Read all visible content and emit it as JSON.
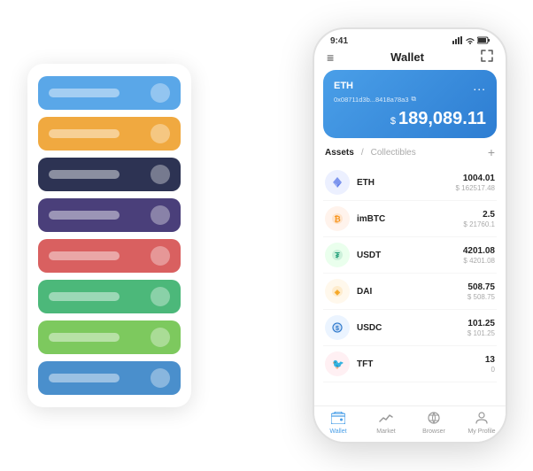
{
  "cardStack": {
    "items": [
      {
        "color": "card-blue"
      },
      {
        "color": "card-orange"
      },
      {
        "color": "card-dark"
      },
      {
        "color": "card-purple"
      },
      {
        "color": "card-red"
      },
      {
        "color": "card-green"
      },
      {
        "color": "card-lightgreen"
      },
      {
        "color": "card-steelblue"
      }
    ]
  },
  "phone": {
    "statusBar": {
      "time": "9:41",
      "signal": "●●●",
      "wifi": "▲",
      "battery": "█"
    },
    "header": {
      "menuIcon": "≡",
      "title": "Wallet",
      "expandIcon": "⤢"
    },
    "ethCard": {
      "label": "ETH",
      "dots": "...",
      "address": "0x08711d3b...8418a78a3",
      "addressIcon": "⧉",
      "balanceDollar": "$",
      "balance": "189,089.11"
    },
    "assets": {
      "activeTab": "Assets",
      "slash": "/",
      "inactiveTab": "Collectibles",
      "addIcon": "+"
    },
    "assetList": [
      {
        "name": "ETH",
        "iconEmoji": "◈",
        "iconClass": "icon-eth",
        "amount": "1004.01",
        "usdValue": "$ 162517.48"
      },
      {
        "name": "imBTC",
        "iconEmoji": "₿",
        "iconClass": "icon-imbtc",
        "amount": "2.5",
        "usdValue": "$ 21760.1"
      },
      {
        "name": "USDT",
        "iconEmoji": "₮",
        "iconClass": "icon-usdt",
        "amount": "4201.08",
        "usdValue": "$ 4201.08"
      },
      {
        "name": "DAI",
        "iconEmoji": "◎",
        "iconClass": "icon-dai",
        "amount": "508.75",
        "usdValue": "$ 508.75"
      },
      {
        "name": "USDC",
        "iconEmoji": "⊕",
        "iconClass": "icon-usdc",
        "amount": "101.25",
        "usdValue": "$ 101.25"
      },
      {
        "name": "TFT",
        "iconEmoji": "❦",
        "iconClass": "icon-tft",
        "amount": "13",
        "usdValue": "0"
      }
    ],
    "nav": [
      {
        "icon": "◎",
        "label": "Wallet",
        "active": true
      },
      {
        "icon": "📈",
        "label": "Market",
        "active": false
      },
      {
        "icon": "🌐",
        "label": "Browser",
        "active": false
      },
      {
        "icon": "👤",
        "label": "My Profile",
        "active": false
      }
    ]
  }
}
